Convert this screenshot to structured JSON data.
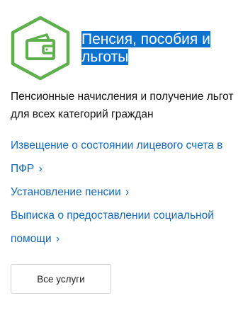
{
  "category": {
    "icon": "wallet-icon",
    "accent_color": "#5db04b",
    "title_highlight_color": "#0b73cf",
    "title": "Пенсия, пособия и льготы",
    "description": "Пенсионные начисления и получение льгот для всех категорий граждан",
    "links": [
      {
        "label": "Извещение о состоянии лицевого счета в ПФР"
      },
      {
        "label": "Установление пенсии"
      },
      {
        "label": "Выписка о предоставлении социальной помощи"
      }
    ],
    "chevron": "›",
    "all_services_label": "Все услуги"
  }
}
